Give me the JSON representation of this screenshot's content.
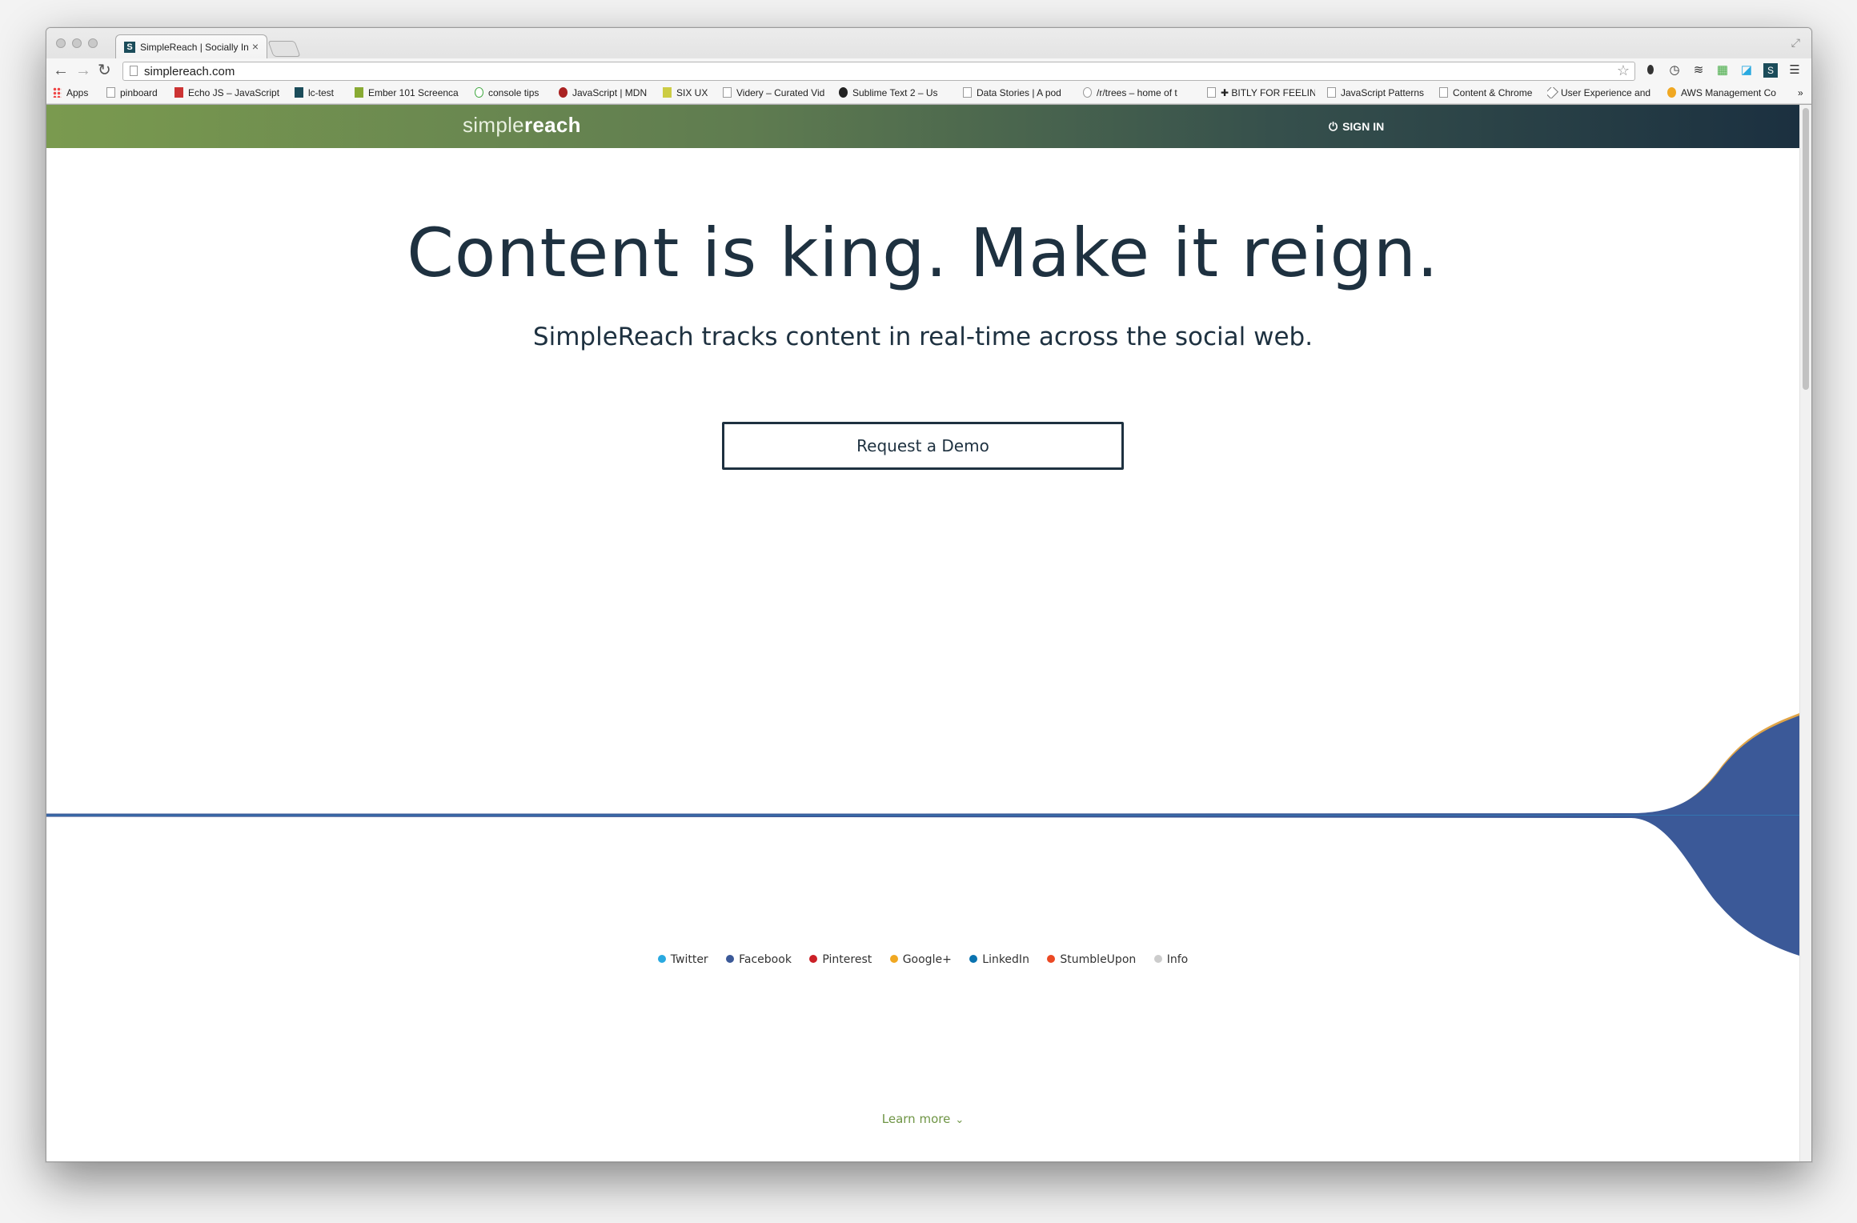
{
  "browser": {
    "tab_title": "SimpleReach | Socially Inte",
    "tab_favicon": "S",
    "tab_close": "×",
    "url": "simplereach.com",
    "bookmarks": [
      {
        "label": "Apps",
        "icon": "apps-grid-icon"
      },
      {
        "label": "pinboard",
        "icon": "page-icon"
      },
      {
        "label": "Echo JS – JavaScript",
        "icon": "js-icon"
      },
      {
        "label": "lc-test",
        "icon": "s-icon"
      },
      {
        "label": "Ember 101 Screenca",
        "icon": "ember-icon"
      },
      {
        "label": "console tips",
        "icon": "chrome-icon"
      },
      {
        "label": "JavaScript | MDN",
        "icon": "mdn-icon"
      },
      {
        "label": "SIX UX",
        "icon": "six-icon"
      },
      {
        "label": "Videry – Curated Vid",
        "icon": "page-icon"
      },
      {
        "label": "Sublime Text 2 – Us",
        "icon": "github-icon"
      },
      {
        "label": "Data Stories | A pod",
        "icon": "page-icon"
      },
      {
        "label": "/r/trees – home of t",
        "icon": "reddit-icon"
      },
      {
        "label": "✚ BITLY FOR FEELING",
        "icon": "page-icon"
      },
      {
        "label": "JavaScript Patterns",
        "icon": "page-icon"
      },
      {
        "label": "Content & Chrome",
        "icon": "page-icon"
      },
      {
        "label": "User Experience and",
        "icon": "diamond-icon"
      },
      {
        "label": "AWS Management Co",
        "icon": "aws-icon"
      }
    ],
    "bookmarks_overflow": "»"
  },
  "site": {
    "logo_light": "simple",
    "logo_bold": "reach",
    "signin_icon": "⏻",
    "signin_label": "SIGN IN",
    "hero_title": "Content is king. Make it reign.",
    "hero_subtitle": "SimpleReach tracks content in real-time across the social web.",
    "demo_button": "Request a Demo",
    "legend": [
      {
        "label": "Twitter",
        "color": "#29a9e0"
      },
      {
        "label": "Facebook",
        "color": "#3b5998"
      },
      {
        "label": "Pinterest",
        "color": "#cb2027"
      },
      {
        "label": "Google+",
        "color": "#f0a822"
      },
      {
        "label": "LinkedIn",
        "color": "#0a73b0"
      },
      {
        "label": "StumbleUpon",
        "color": "#eb4924"
      },
      {
        "label": "Info",
        "color": "#cccccc"
      }
    ],
    "learn_more": "Learn more",
    "learn_more_icon": "⌄"
  },
  "colors": {
    "stream_facebook": "#3b5998",
    "stream_googleplus": "#e0a548",
    "text_dark": "#1e3140",
    "accent_green": "#6f9545"
  }
}
